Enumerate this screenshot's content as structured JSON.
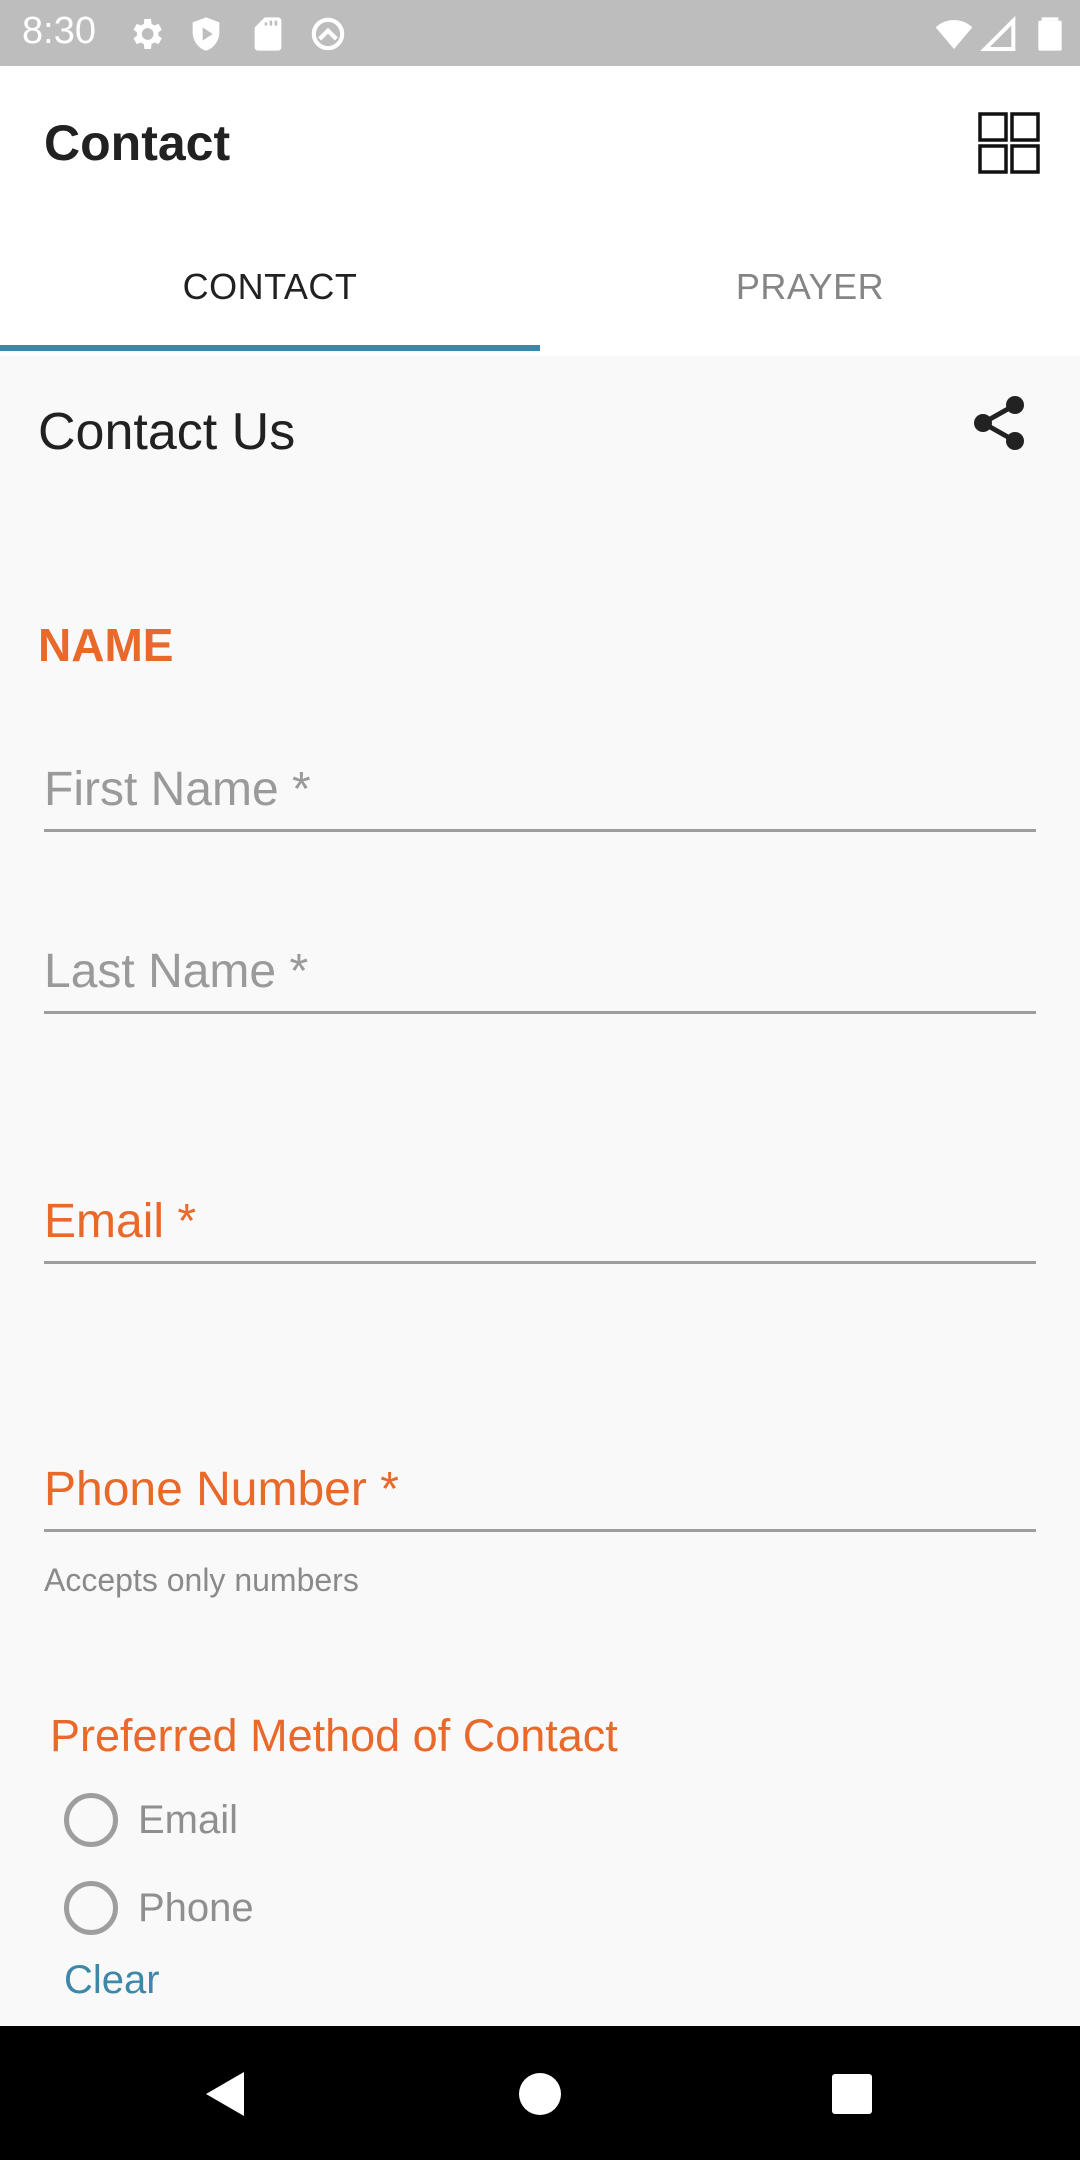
{
  "status_bar": {
    "time": "8:30",
    "left_icons": [
      "settings-icon",
      "shield-play-icon",
      "sd-card-icon",
      "q-logo-icon"
    ],
    "right_icons": [
      "wifi-icon",
      "cellular-signal-icon",
      "battery-icon"
    ]
  },
  "app_bar": {
    "title": "Contact",
    "menu_icon": "grid-icon"
  },
  "tabs": [
    {
      "label": "CONTACT",
      "selected": true
    },
    {
      "label": "PRAYER",
      "selected": false
    }
  ],
  "form": {
    "title": "Contact Us",
    "share_icon": "share-icon",
    "name_section_label": "NAME",
    "fields": {
      "first_name": {
        "label": "First Name *",
        "value": ""
      },
      "last_name": {
        "label": "Last Name *",
        "value": ""
      },
      "email": {
        "label": "Email *",
        "value": ""
      },
      "phone": {
        "label": "Phone Number *",
        "value": "",
        "helper": "Accepts only numbers"
      }
    },
    "preferred_contact": {
      "label": "Preferred Method of Contact",
      "options": [
        {
          "label": "Email",
          "checked": false
        },
        {
          "label": "Phone",
          "checked": false
        }
      ],
      "clear_label": "Clear"
    }
  },
  "colors": {
    "accent_orange": "#e8692a",
    "accent_blue": "#3d87a8"
  },
  "nav_bar": {
    "buttons": [
      "back-icon",
      "home-icon",
      "recents-icon"
    ]
  }
}
